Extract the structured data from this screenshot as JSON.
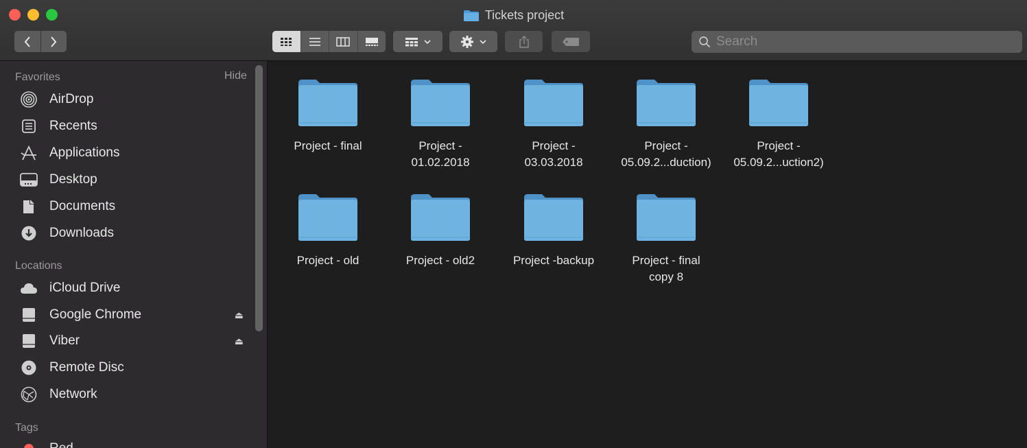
{
  "window": {
    "title": "Tickets project"
  },
  "toolbar": {
    "search_placeholder": "Search"
  },
  "sidebar": {
    "favorites_header": "Favorites",
    "hide_label": "Hide",
    "favorites": [
      {
        "label": "AirDrop",
        "icon": "airdrop-icon"
      },
      {
        "label": "Recents",
        "icon": "recents-icon"
      },
      {
        "label": "Applications",
        "icon": "applications-icon"
      },
      {
        "label": "Desktop",
        "icon": "desktop-icon"
      },
      {
        "label": "Documents",
        "icon": "documents-icon"
      },
      {
        "label": "Downloads",
        "icon": "downloads-icon"
      }
    ],
    "locations_header": "Locations",
    "locations": [
      {
        "label": "iCloud Drive",
        "icon": "cloud-icon"
      },
      {
        "label": "Google Chrome",
        "icon": "drive-icon",
        "eject": true
      },
      {
        "label": "Viber",
        "icon": "drive-icon",
        "eject": true
      },
      {
        "label": "Remote Disc",
        "icon": "disc-icon"
      },
      {
        "label": "Network",
        "icon": "network-icon"
      }
    ],
    "tags_header": "Tags",
    "tags": [
      {
        "label": "Red",
        "color": "#ff5f57"
      }
    ]
  },
  "files": [
    {
      "line1": "Project - final",
      "line2": ""
    },
    {
      "line1": "Project -",
      "line2": "01.02.2018"
    },
    {
      "line1": "Project -",
      "line2": "03.03.2018"
    },
    {
      "line1": "Project -",
      "line2": "05.09.2...duction)"
    },
    {
      "line1": "Project -",
      "line2": "05.09.2...uction2)"
    },
    {
      "line1": "Project - old",
      "line2": ""
    },
    {
      "line1": "Project - old2",
      "line2": ""
    },
    {
      "line1": "Project -backup",
      "line2": ""
    },
    {
      "line1": "Project - final",
      "line2": "copy 8"
    }
  ],
  "colors": {
    "folder": "#6fb3e0",
    "accent": "#0a84ff"
  }
}
